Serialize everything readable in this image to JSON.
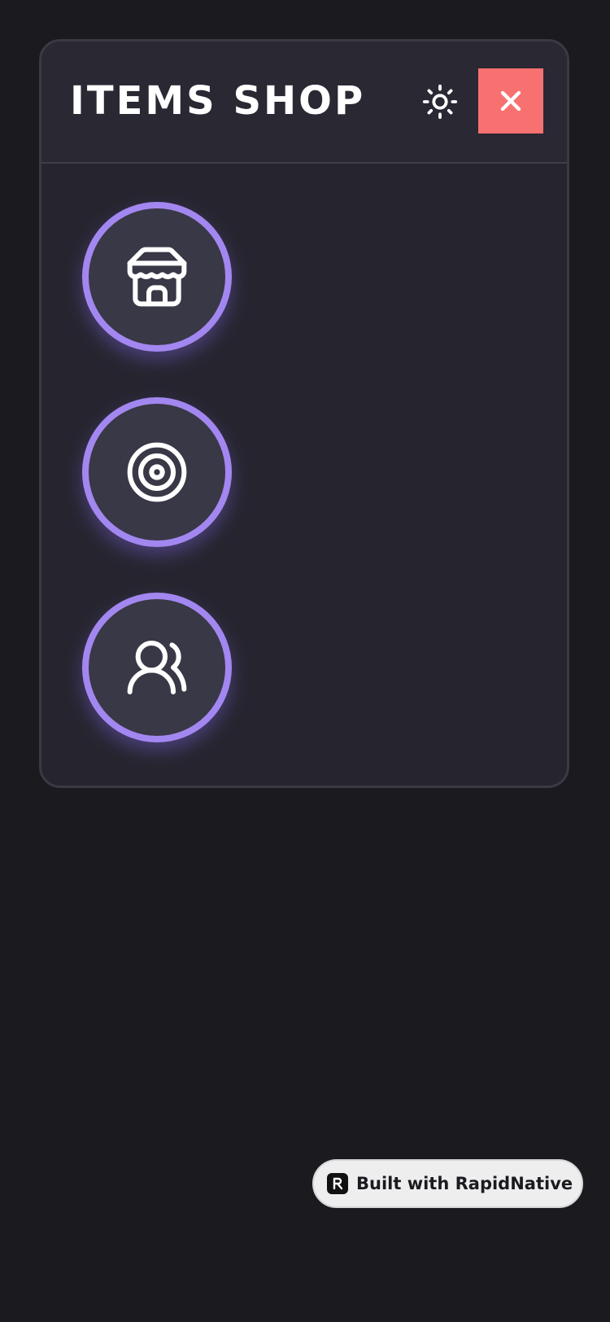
{
  "header": {
    "title": "ITEMS SHOP",
    "theme_toggle_icon": "sun-icon",
    "close_icon": "close-icon"
  },
  "menu": {
    "buttons": [
      {
        "id": "shop",
        "icon": "store-icon"
      },
      {
        "id": "target",
        "icon": "target-icon"
      },
      {
        "id": "users",
        "icon": "users-icon"
      }
    ]
  },
  "badge": {
    "label": "Built with RapidNative",
    "icon": "rapidnative-logo-icon"
  },
  "colors": {
    "background": "#1b1a1f",
    "panel": "#26252f",
    "header": "#292833",
    "accent_ring": "#a387f0",
    "circle_fill": "#393846",
    "close_button": "#f87171",
    "badge_background": "#eeeeef"
  }
}
